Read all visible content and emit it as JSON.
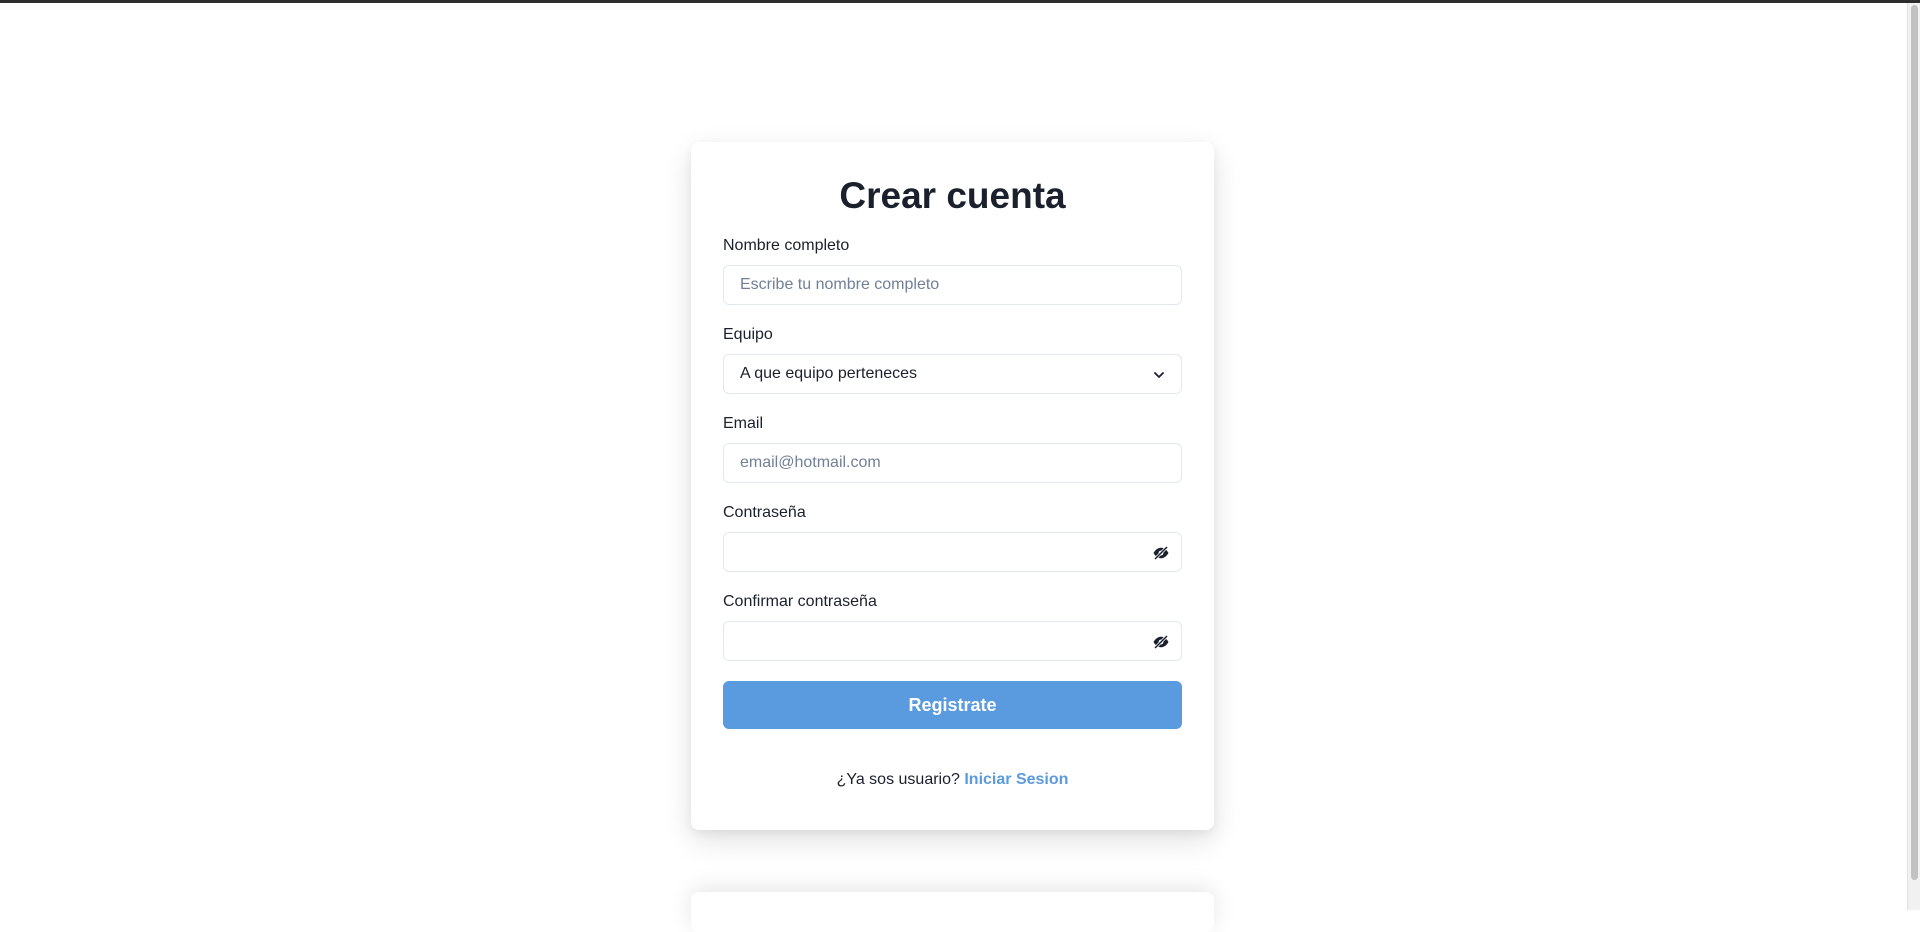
{
  "form": {
    "title": "Crear cuenta",
    "name_label": "Nombre completo",
    "name_placeholder": "Escribe tu nombre completo",
    "team_label": "Equipo",
    "team_selected": "A que equipo perteneces",
    "email_label": "Email",
    "email_placeholder": "email@hotmail.com",
    "password_label": "Contraseña",
    "confirm_label": "Confirmar contraseña",
    "submit_label": "Registrate",
    "footer_text": "¿Ya sos usuario?",
    "login_link": "Iniciar Sesion"
  },
  "colors": {
    "accent": "#5a9ade",
    "text": "#1a202c",
    "border": "#e2e8f0",
    "placeholder": "#718096"
  },
  "icons": {
    "team_select": "chevron-down-icon",
    "password_toggle": "eye-off-icon",
    "confirm_toggle": "eye-off-icon"
  }
}
